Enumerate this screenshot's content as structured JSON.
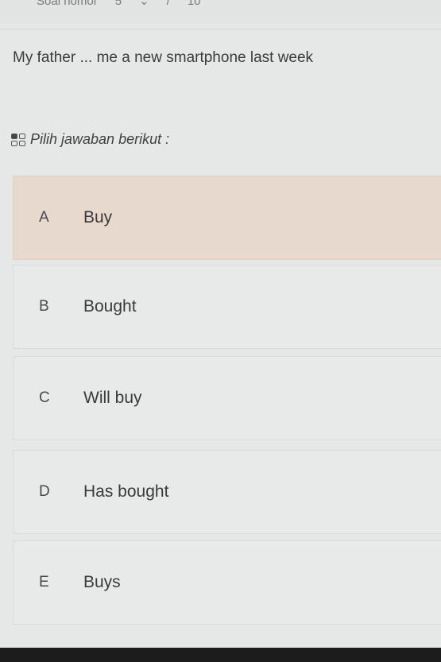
{
  "header": {
    "label": "Soal nomor",
    "current": "5",
    "separator": "/",
    "total": "10"
  },
  "question": {
    "text": "My father ... me a new smartphone last week"
  },
  "instruction": {
    "icon": "grid-icon",
    "text": "Pilih jawaban berikut :"
  },
  "options": [
    {
      "letter": "A",
      "text": "Buy",
      "selected": true
    },
    {
      "letter": "B",
      "text": "Bought",
      "selected": false
    },
    {
      "letter": "C",
      "text": "Will buy",
      "selected": false
    },
    {
      "letter": "D",
      "text": "Has bought",
      "selected": false
    },
    {
      "letter": "E",
      "text": "Buys",
      "selected": false
    }
  ],
  "colors": {
    "background": "#e6e8e8",
    "selected_option": "#e8d9ce",
    "option": "#e8eaea"
  }
}
